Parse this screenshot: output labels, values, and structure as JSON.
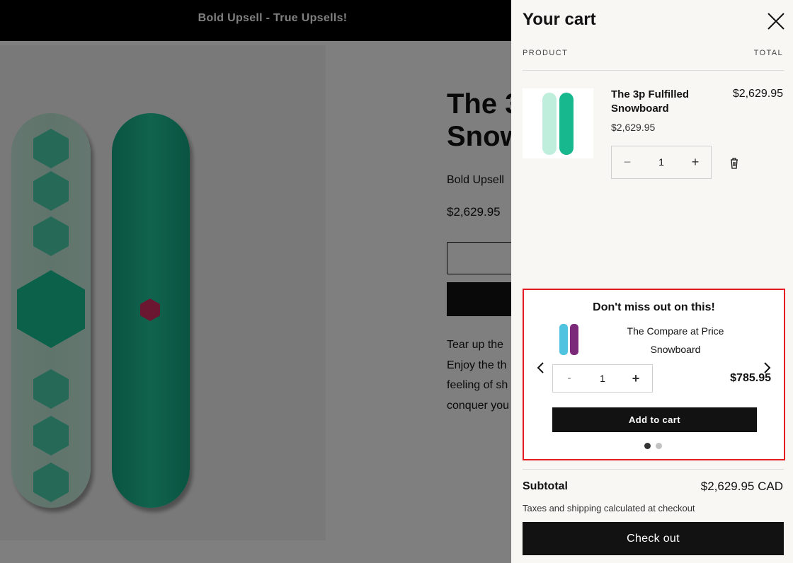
{
  "announcement": {
    "text": "Bold Upsell - True Upsells!"
  },
  "product_page": {
    "title": "The 3p Fulfilled Snowboard",
    "title_visible_line1": "The 3",
    "title_visible_line2": "Snow",
    "vendor": "Bold Upsell",
    "price": "$2,629.95",
    "description_lines": [
      "Tear up the",
      "Enjoy the th",
      "feeling of sh",
      "conquer you"
    ]
  },
  "cart": {
    "title": "Your cart",
    "columns": {
      "product": "PRODUCT",
      "total": "TOTAL"
    },
    "items": [
      {
        "name": "The 3p Fulfilled Snowboard",
        "unit_price": "$2,629.95",
        "line_total": "$2,629.95",
        "quantity": "1",
        "minus_symbol": "−",
        "plus_symbol": "+"
      }
    ],
    "upsell": {
      "heading": "Don't miss out on this!",
      "product_name": "The Compare at Price Snowboard",
      "quantity": "1",
      "minus_symbol": "-",
      "plus_symbol": "+",
      "price": "$785.95",
      "button_label": "Add to cart",
      "carousel_pages": 2,
      "active_page": 1
    },
    "subtotal_label": "Subtotal",
    "subtotal_value": "$2,629.95 CAD",
    "tax_note": "Taxes and shipping calculated at checkout",
    "checkout_label": "Check out"
  },
  "colors": {
    "accent_black": "#121212",
    "upsell_border": "#e21c21",
    "drawer_bg": "#f8f7f4"
  },
  "icons": [
    "close-icon",
    "trash-icon",
    "chevron-left-icon",
    "chevron-right-icon"
  ]
}
